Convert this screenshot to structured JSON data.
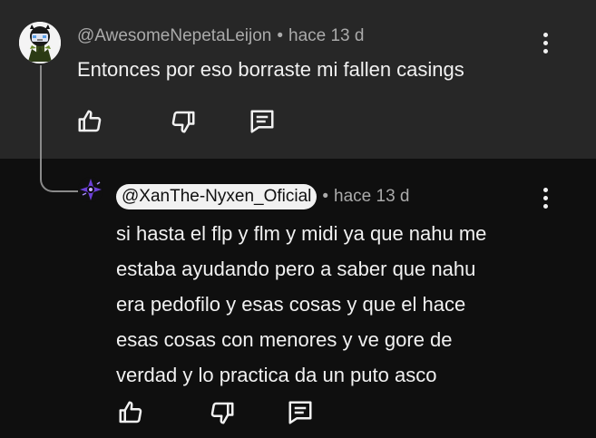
{
  "comments": [
    {
      "author": "@AwesomeNepetaLeijon",
      "separator": "•",
      "time": "hace 13 d",
      "text": "Entonces por eso borraste mi fallen casings",
      "avatar": "cartoon-character-avatar"
    },
    {
      "author": "@XanThe-Nyxen_Oficial",
      "separator": "•",
      "time": "hace 13 d",
      "text_lines": [
        "si hasta el flp y flm y midi ya que nahu me",
        "estaba ayudando pero a saber que nahu",
        "era pedofilo y esas cosas y que el hace",
        "esas cosas con menores y ve gore de",
        "verdad y lo practica da un puto asco"
      ],
      "avatar": "purple-star-avatar"
    }
  ],
  "icons": {
    "like": "thumb-up-icon",
    "dislike": "thumb-down-icon",
    "reply": "comment-icon",
    "menu": "more-vert-icon"
  },
  "colors": {
    "top_background": "#272727",
    "background": "#0f0f0f",
    "text": "#f1f1f1",
    "meta": "#aaaaaa",
    "pill": "#f1f1f1"
  }
}
